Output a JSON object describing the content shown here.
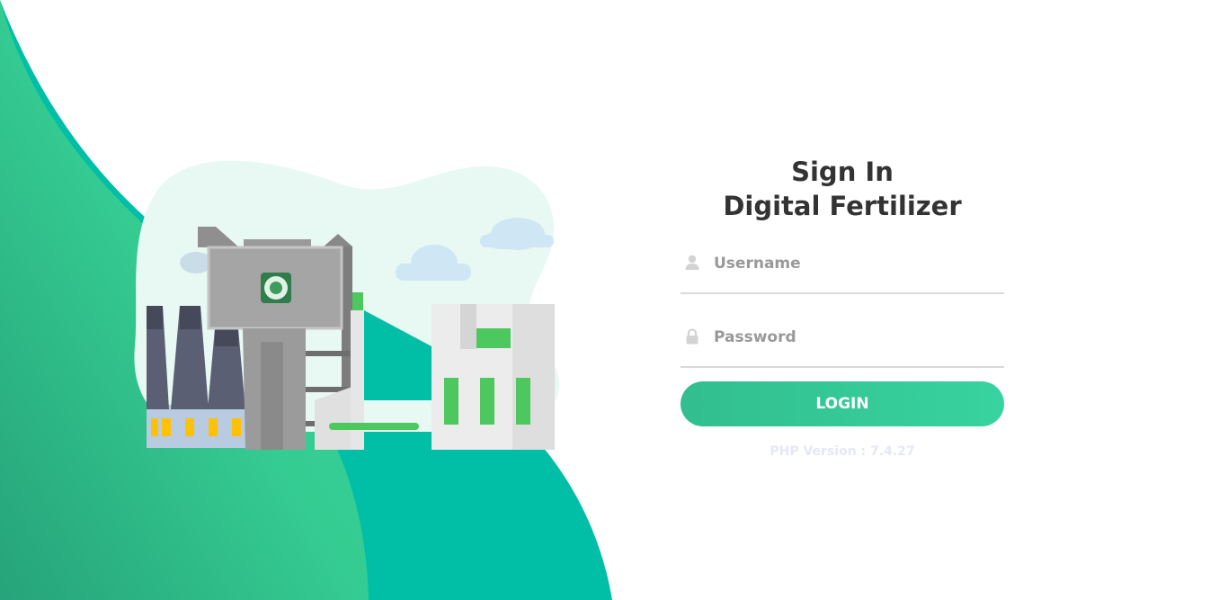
{
  "form": {
    "title_line1": "Sign In",
    "title_line2": "Digital Fertilizer",
    "username_placeholder": "Username",
    "password_placeholder": "Password",
    "login_label": "LOGIN"
  },
  "footer": {
    "php_version": "PHP Version : 7.4.27"
  },
  "icons": {
    "username": "user-icon",
    "password": "lock-icon"
  },
  "colors": {
    "accent": "#38d39f",
    "accent_dark": "#32be8f",
    "wave_teal": "#00bfa6",
    "title_text": "#333333",
    "placeholder_text": "#999999",
    "version_text": "#e6e6fa"
  }
}
